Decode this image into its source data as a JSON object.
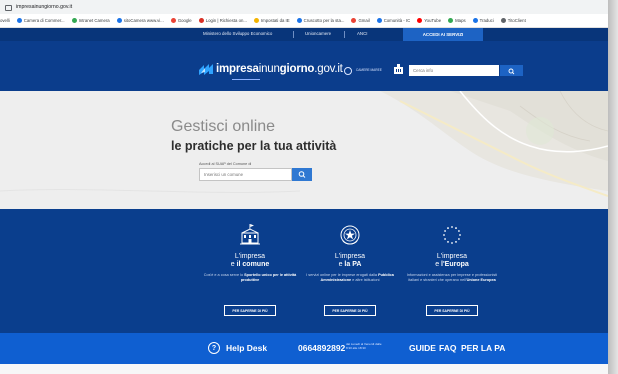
{
  "browser": {
    "url": "impresainungiorno.gov.it",
    "bookmarks": [
      {
        "label": "ovelli",
        "color": "#5f6368"
      },
      {
        "label": "Camera di Commer...",
        "color": "#1a73e8"
      },
      {
        "label": "Intranet Camera",
        "color": "#34a853"
      },
      {
        "label": "sitoCamera www.vi...",
        "color": "#1a73e8"
      },
      {
        "label": "Google",
        "color": "#ea4335"
      },
      {
        "label": "Login | Richiesta on...",
        "color": "#d93025"
      },
      {
        "label": "Impostati da IE",
        "color": "#f4b400"
      },
      {
        "label": "Cruscotto per la sta...",
        "color": "#1a73e8"
      },
      {
        "label": "Gmail",
        "color": "#ea4335"
      },
      {
        "label": "Comunità - IC",
        "color": "#1a73e8"
      },
      {
        "label": "YouTube",
        "color": "#ff0000"
      },
      {
        "label": "Maps",
        "color": "#34a853"
      },
      {
        "label": "Traduci",
        "color": "#1a73e8"
      },
      {
        "label": "TitoClient",
        "color": "#5f6368"
      }
    ]
  },
  "topnav": {
    "links": [
      "Ministero dello Sviluppo Economico",
      "Unioncamere",
      "ANCI"
    ],
    "access": "ACCEDI AI SERVIZI"
  },
  "header": {
    "logo_bold": "impresa",
    "logo_mid": "inun",
    "logo_bold2": "giorno",
    "logo_tail": ".gov.it",
    "cam_label": "CAMERE MAREE",
    "search_placeholder": "Cerca info"
  },
  "hero": {
    "title1": "Gestisci online",
    "title2": "le pratiche per la tua attività",
    "caption": "Accedi al SUAP del Comune di",
    "comune_placeholder": "Inserisci un comune"
  },
  "cards": [
    {
      "line1": "L'impresa",
      "pre": "e ",
      "bold": "il comune",
      "desc_plain": "Cos'è e a cosa serve lo",
      "desc_bold": "Sportello unico per le attività produttive",
      "more": "PER SAPERNE DI PIÙ"
    },
    {
      "line1": "L'impresa",
      "pre": "e ",
      "bold": "la PA",
      "desc_plain": "I servizi online per le imprese erogati dalla",
      "desc_bold": "Pubblica Amministrazione",
      "desc_tail": "e altre istituzioni",
      "more": "PER SAPERNE DI PIÙ"
    },
    {
      "line1": "L'impresa",
      "pre": "e ",
      "bold": "l'Europa",
      "desc_plain": "Informazioni e assistenza per imprese e professionisti italiani e stranieri che operano nell'",
      "desc_bold": "Unione Europea",
      "more": "PER SAPERNE DI PIÙ"
    }
  ],
  "helpbar": {
    "help": "Help Desk",
    "phone": "0664892892",
    "phone_note": "dal Lunedì al Venerdì dalle 8:30 alle 18:30",
    "guide": "GUIDE",
    "faq": "FAQ",
    "pa": "PER LA PA"
  },
  "colors": {
    "topnav": "#08357a",
    "header": "#0b3d8c",
    "cards": "#0a3e8d",
    "helpbar": "#0f5fd1",
    "accent": "#1d63c4"
  }
}
